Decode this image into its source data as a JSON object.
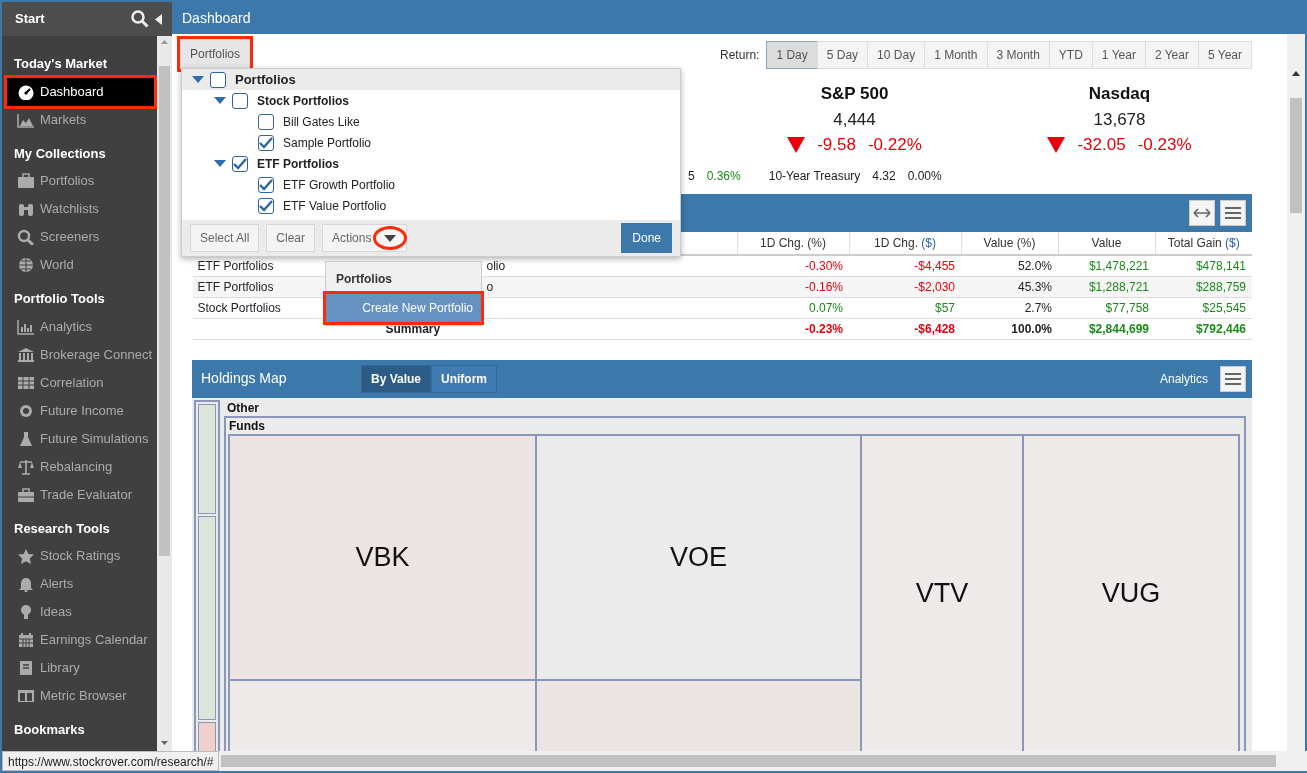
{
  "sidebar": {
    "title": "Start",
    "sections": [
      {
        "heading": "Today's Market",
        "items": [
          {
            "label": "Dashboard",
            "selected": true,
            "highlighted": true
          },
          {
            "label": "Markets",
            "selected": false,
            "highlighted": false
          }
        ]
      },
      {
        "heading": "My Collections",
        "items": [
          {
            "label": "Portfolios",
            "selected": false,
            "highlighted": false
          },
          {
            "label": "Watchlists",
            "selected": false,
            "highlighted": false
          },
          {
            "label": "Screeners",
            "selected": false,
            "highlighted": false
          },
          {
            "label": "World",
            "selected": false,
            "highlighted": false
          }
        ]
      },
      {
        "heading": "Portfolio Tools",
        "items": [
          {
            "label": "Analytics",
            "selected": false,
            "highlighted": false
          },
          {
            "label": "Brokerage Connect",
            "selected": false,
            "highlighted": false
          },
          {
            "label": "Correlation",
            "selected": false,
            "highlighted": false
          },
          {
            "label": "Future Income",
            "selected": false,
            "highlighted": false
          },
          {
            "label": "Future Simulations",
            "selected": false,
            "highlighted": false
          },
          {
            "label": "Rebalancing",
            "selected": false,
            "highlighted": false
          },
          {
            "label": "Trade Evaluator",
            "selected": false,
            "highlighted": false
          }
        ]
      },
      {
        "heading": "Research Tools",
        "items": [
          {
            "label": "Stock Ratings",
            "selected": false,
            "highlighted": false
          },
          {
            "label": "Alerts",
            "selected": false,
            "highlighted": false
          },
          {
            "label": "Ideas",
            "selected": false,
            "highlighted": false
          },
          {
            "label": "Earnings Calendar",
            "selected": false,
            "highlighted": false
          },
          {
            "label": "Library",
            "selected": false,
            "highlighted": false
          },
          {
            "label": "Metric Browser",
            "selected": false,
            "highlighted": false
          }
        ]
      },
      {
        "heading": "Bookmarks"
      }
    ]
  },
  "header": {
    "title": "Dashboard"
  },
  "portfolios_button": {
    "label": "Portfolios",
    "highlighted": true
  },
  "return_tabs": {
    "label": "Return:",
    "tabs": [
      {
        "label": "1 Day",
        "selected": true
      },
      {
        "label": "5 Day",
        "selected": false
      },
      {
        "label": "10 Day",
        "selected": false
      },
      {
        "label": "1 Month",
        "selected": false
      },
      {
        "label": "3 Month",
        "selected": false
      },
      {
        "label": "YTD",
        "selected": false
      },
      {
        "label": "1 Year",
        "selected": false
      },
      {
        "label": "2 Year",
        "selected": false
      },
      {
        "label": "5 Year",
        "selected": false
      }
    ]
  },
  "indices": [
    {
      "name": "S&P 500",
      "value": "4,444",
      "change": "-9.58",
      "percent": "-0.22%",
      "falling": true,
      "color": "#e8000b"
    },
    {
      "name": "Nasdaq",
      "value": "13,678",
      "change": "-32.05",
      "percent": "-0.23%",
      "falling": true,
      "color": "#e8000b"
    }
  ],
  "small_stats": [
    {
      "text": "5",
      "color": "#222222"
    },
    {
      "text": "0.36%",
      "color": "#1a8a1a"
    },
    {
      "text": "10-Year Treasury",
      "color": "#222222"
    },
    {
      "text": "4.32",
      "color": "#222222"
    },
    {
      "text": "0.00%",
      "color": "#222222"
    }
  ],
  "portfolio_popup": {
    "tree": [
      {
        "label": "Portfolios",
        "checked": false,
        "expanded": true,
        "children": [
          {
            "label": "Stock Portfolios",
            "checked": false,
            "expanded": true,
            "children": [
              {
                "label": "Bill Gates Like",
                "checked": false
              },
              {
                "label": "Sample Portfolio",
                "checked": true
              }
            ]
          },
          {
            "label": "ETF Portfolios",
            "checked": true,
            "expanded": true,
            "children": [
              {
                "label": "ETF Growth Portfolio",
                "checked": true
              },
              {
                "label": "ETF Value Portfolio",
                "checked": true
              }
            ]
          }
        ]
      }
    ],
    "buttons": [
      "Select All",
      "Clear"
    ],
    "actions": {
      "label": "Actions",
      "circled": true
    },
    "done": "Done"
  },
  "actions_menu": {
    "heading": "Portfolios",
    "items": [
      {
        "label": "Create New Portfolio",
        "selected": true,
        "highlighted": true
      }
    ]
  },
  "table": {
    "columns": [
      {
        "label": "1D Chg.",
        "unit": "(%)",
        "unit_highlight": false
      },
      {
        "label": "1D Chg.",
        "unit": "($)",
        "unit_highlight": true
      },
      {
        "label": "Value",
        "unit": "(%)",
        "unit_highlight": false
      },
      {
        "label": "Value"
      },
      {
        "label": "Total Gain",
        "unit": "($)",
        "unit_highlight": true
      }
    ],
    "rows": [
      {
        "kind": "data",
        "name": "ETF Portfolios",
        "column_2": "olio",
        "cells": [
          {
            "text": "-0.30%",
            "color": "#e8000b"
          },
          {
            "text": "-$4,455",
            "color": "#e8000b"
          },
          {
            "text": "52.0%",
            "color": "#222222"
          },
          {
            "text": "$1,478,221",
            "color": "#1a8a1a"
          },
          {
            "text": "$478,141",
            "color": "#1a8a1a"
          }
        ]
      },
      {
        "kind": "data",
        "name": "ETF Portfolios",
        "column_2": "o",
        "cells": [
          {
            "text": "-0.16%",
            "color": "#e8000b"
          },
          {
            "text": "-$2,030",
            "color": "#e8000b"
          },
          {
            "text": "45.3%",
            "color": "#222222"
          },
          {
            "text": "$1,288,721",
            "color": "#1a8a1a"
          },
          {
            "text": "$288,759",
            "color": "#1a8a1a"
          }
        ]
      },
      {
        "kind": "data",
        "name": "Stock Portfolios",
        "cells": [
          {
            "text": "0.07%",
            "color": "#1a8a1a"
          },
          {
            "text": "$57",
            "color": "#1a8a1a"
          },
          {
            "text": "2.7%",
            "color": "#222222"
          },
          {
            "text": "$77,758",
            "color": "#1a8a1a"
          },
          {
            "text": "$25,545",
            "color": "#1a8a1a"
          }
        ]
      },
      {
        "kind": "summary",
        "column_2": "Summary",
        "cells": [
          {
            "text": "-0.23%",
            "color": "#e8000b"
          },
          {
            "text": "-$6,428",
            "color": "#e8000b"
          },
          {
            "text": "100.0%",
            "color": "#222222"
          },
          {
            "text": "$2,844,699",
            "color": "#1a8a1a"
          },
          {
            "text": "$792,446",
            "color": "#1a8a1a"
          }
        ]
      }
    ]
  },
  "holdings_map": {
    "title": "Holdings Map",
    "modes": [
      {
        "label": "By Value",
        "selected": true
      },
      {
        "label": "Uniform",
        "selected": false
      }
    ],
    "analytics": "Analytics",
    "groups": [
      {
        "label": "Other"
      },
      {
        "label": "Funds"
      }
    ],
    "tiles": [
      {
        "label": "VBK",
        "color": "#ece4e3"
      },
      {
        "label": "VOE",
        "color": "#ebebeb"
      },
      {
        "label": "VTV",
        "color": "#eeeae9"
      },
      {
        "label": "VUG",
        "color": "#eeeae9"
      }
    ]
  },
  "status_bar": {
    "url": "https://www.stockrover.com/research/#"
  }
}
